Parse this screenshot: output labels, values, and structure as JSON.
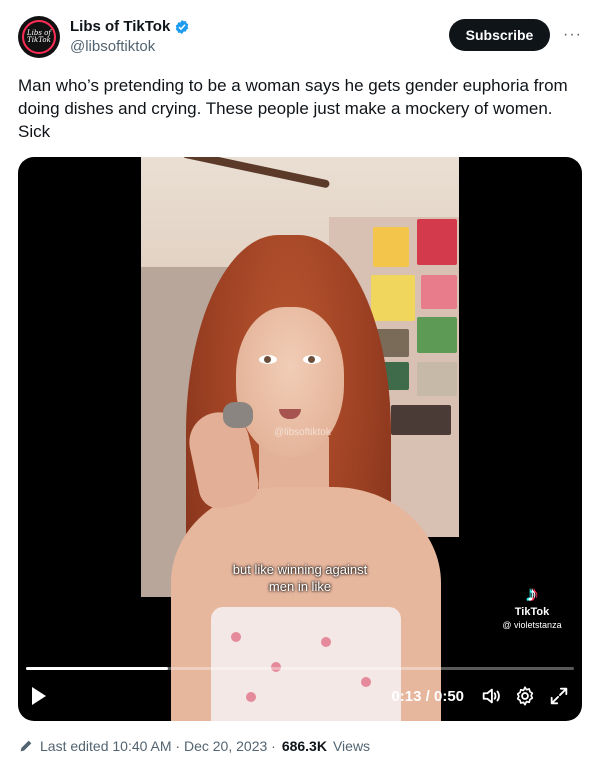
{
  "author": {
    "display_name": "Libs of TikTok",
    "handle": "@libsoftiktok",
    "avatar_text": "Libs of TikTok",
    "verified_color": "#1d9bf0"
  },
  "actions": {
    "subscribe_label": "Subscribe",
    "more_label": "···"
  },
  "tweet": {
    "text": "Man who’s pretending to be a woman says he gets gender euphoria from doing dishes and crying. These people just make a mockery of women. Sick"
  },
  "video": {
    "watermark": "@libsoftiktok",
    "caption_line1": "but like winning against",
    "caption_line2": "men in like",
    "tiktok_label": "TikTok",
    "tiktok_user": "@ violetstanza",
    "time_display": "0:13 / 0:50",
    "progress": 0.26,
    "icons": [
      "play-icon",
      "volume-icon",
      "settings-icon",
      "fullscreen-icon"
    ]
  },
  "footer": {
    "edited_text": "Last edited 10:40 AM · Dec 20, 2023 ·",
    "views_count": "686.3K",
    "views_label": "Views"
  }
}
